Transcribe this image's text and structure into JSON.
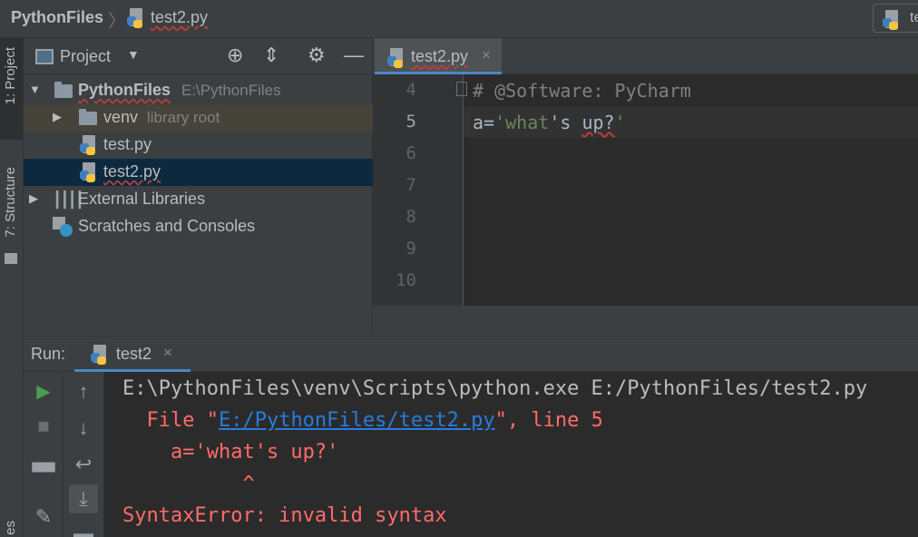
{
  "navbar": {
    "project": "PythonFiles",
    "separator": "〉",
    "file": "test2.py",
    "run_config": "te"
  },
  "stripe": {
    "project_tab": "1: Project",
    "structure_tab": "7: Structure",
    "bottom_tab": "es"
  },
  "project_panel": {
    "title": "Project",
    "caret": "▼",
    "tree": [
      {
        "label": "PythonFiles",
        "hint": "E:\\PythonFiles"
      },
      {
        "label": "venv",
        "hint": "library root"
      },
      {
        "label": "test.py"
      },
      {
        "label": "test2.py"
      },
      {
        "label": "External Libraries"
      },
      {
        "label": "Scratches and Consoles"
      }
    ]
  },
  "editor": {
    "tab_label": "test2.py",
    "close_glyph": "×",
    "line_numbers": [
      "4",
      "5",
      "6",
      "7",
      "8",
      "9",
      "10"
    ],
    "code": {
      "line4": "# @Software: PyCharm",
      "line5_var": "a=",
      "line5_q1": "'",
      "line5_w1": "what",
      "line5_mid": "'s ",
      "line5_w2": "up?",
      "line5_q2": "'"
    }
  },
  "run": {
    "label": "Run:",
    "tab_label": "test2",
    "close_glyph": "×",
    "console": {
      "cmd": "E:\\PythonFiles\\venv\\Scripts\\python.exe E:/PythonFiles/test2.py",
      "file_prefix": "  File \"",
      "file_link": "E:/PythonFiles/test2.py",
      "file_suffix": "\", line 5",
      "code": "    a='what's up?'",
      "caret": "          ^",
      "error": "SyntaxError: invalid syntax"
    }
  },
  "colors": {
    "background": "#2b2b2b",
    "panel": "#3c3f41",
    "selection": "#0d293e",
    "string": "#6a8759",
    "error": "#ff6b68",
    "link": "#287bde",
    "run_green": "#499c54"
  },
  "icons": [
    "python-file-icon",
    "folder-icon",
    "locate-icon",
    "collapse-icon",
    "gear-icon",
    "minimize-icon",
    "rerun-icon",
    "stop-icon",
    "up-arrow-icon",
    "down-arrow-icon",
    "soft-wrap-icon",
    "scroll-to-end-icon",
    "layout-icon",
    "pin-icon",
    "print-icon",
    "libraries-icon",
    "scratches-icon"
  ]
}
